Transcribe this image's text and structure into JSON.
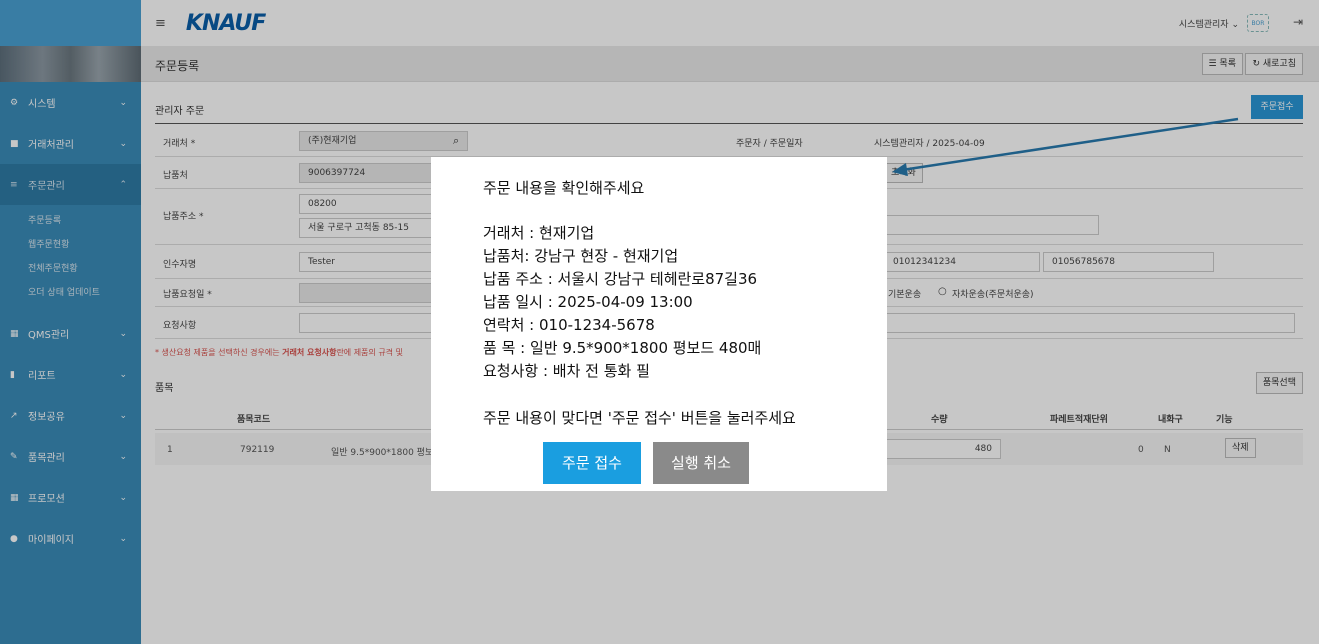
{
  "header": {
    "logo": "KNAUF",
    "hamburger": "≡",
    "user": "시스템관리자 ⌄",
    "user_badge": "BOR",
    "logout_icon": "⇥"
  },
  "sidebar": {
    "items": [
      {
        "icon": "⚙",
        "label": "시스템"
      },
      {
        "icon": "■",
        "label": "거래처관리"
      },
      {
        "icon": "≡",
        "label": "주문관리"
      },
      {
        "icon": "▦",
        "label": "QMS관리"
      },
      {
        "icon": "▮",
        "label": "리포트"
      },
      {
        "icon": "↗",
        "label": "정보공유"
      },
      {
        "icon": "✎",
        "label": "품목관리"
      },
      {
        "icon": "▦",
        "label": "프로모션"
      },
      {
        "icon": "●",
        "label": "마이페이지"
      }
    ],
    "sub_items": [
      "주문등록",
      "웹주문현황",
      "전체주문현황",
      "오더 상태 업데이트"
    ],
    "chevron_down": "⌄",
    "chevron_up": "⌃"
  },
  "page": {
    "title": "주문등록",
    "list_button": "☰ 목록",
    "refresh_button": "↻ 새로고침"
  },
  "form": {
    "section_title": "관리자 주문",
    "submit_button": "주문접수",
    "customer_label": "거래처 *",
    "customer_value": "(주)현재기업",
    "orderer_label": "주문자 / 주문일자",
    "orderer_value": "시스템관리자 / 2025-04-09",
    "delivery_label": "납품처",
    "delivery_value": "9006397724",
    "reset_button": "초기화",
    "address_label": "납품주소 *",
    "zip_value": "08200",
    "address_value": "서울 구로구 고척동 85-15",
    "receiver_label": "인수자명",
    "receiver_value": "Tester",
    "phone1": "01012341234",
    "phone2": "01056785678",
    "date_label": "납품요청일 *",
    "ship_basic": "기본운송",
    "ship_self": "자차운송(주문처운송)",
    "request_label": "요청사항",
    "note_prefix": "* 생산요청 제품을 선택하신 경우에는 ",
    "note_bold": "거래처 요청사항",
    "note_suffix": "란에 제품의 규격 및"
  },
  "items": {
    "section_title": "품목",
    "select_button": "품목선택",
    "columns": {
      "code": "품목코드",
      "qty": "수량",
      "pallet": "파레트적재단위",
      "fire": "내화구",
      "action": "기능"
    },
    "row": {
      "no": "1",
      "code": "792119",
      "name": "일반 9.5*900*1800 평보드",
      "qty": "480",
      "pallet": "0",
      "fire": "N",
      "action": "삭제"
    }
  },
  "dialog": {
    "heading": "주문 내용을 확인해주세요",
    "customer": "거래처 : 현재기업",
    "delivery": "납품처: 강남구 현장 - 현재기업",
    "address": "납품 주소 : 서울시 강남구 테헤란로87길36",
    "datetime": "납품 일시 : 2025-04-09 13:00",
    "contact": "연락처 : 010-1234-5678",
    "product": "품 목 : 일반 9.5*900*1800 평보드 480매",
    "request": "요청사항 : 배차 전 통화 필",
    "instruction": "주문 내용이 맞다면 '주문 접수' 버튼을 눌러주세요",
    "confirm_button": "주문 접수",
    "cancel_button": "실행 취소"
  },
  "colors": {
    "sidebar": "#3a8cb9",
    "primary": "#2a97d6",
    "confirm": "#1a9ee0",
    "cancel": "#8a8a8a",
    "arrow": "#1f5f88"
  }
}
